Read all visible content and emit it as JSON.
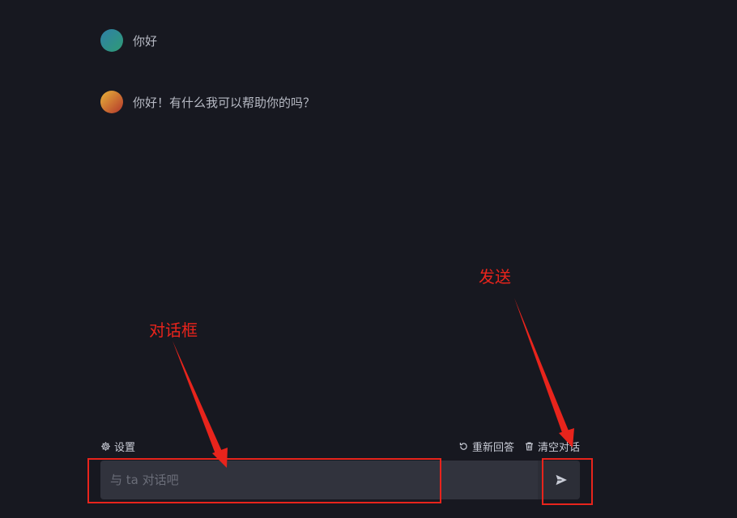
{
  "messages": [
    {
      "role": "user",
      "text": "你好"
    },
    {
      "role": "assistant",
      "text": "你好！有什么我可以帮助你的吗？"
    }
  ],
  "toolbar": {
    "settings_label": "设置",
    "settings_icon": "gear-icon",
    "regenerate_label": "重新回答",
    "regenerate_icon": "refresh-icon",
    "clear_label": "清空对话",
    "clear_icon": "trash-icon"
  },
  "input": {
    "placeholder": "与 ta 对话吧",
    "value": ""
  },
  "send": {
    "icon": "send-icon"
  },
  "annotations": {
    "input_label": "对话框",
    "send_label": "发送",
    "color": "#e8241c"
  },
  "colors": {
    "background": "#171820",
    "input_background": "#31333d"
  }
}
